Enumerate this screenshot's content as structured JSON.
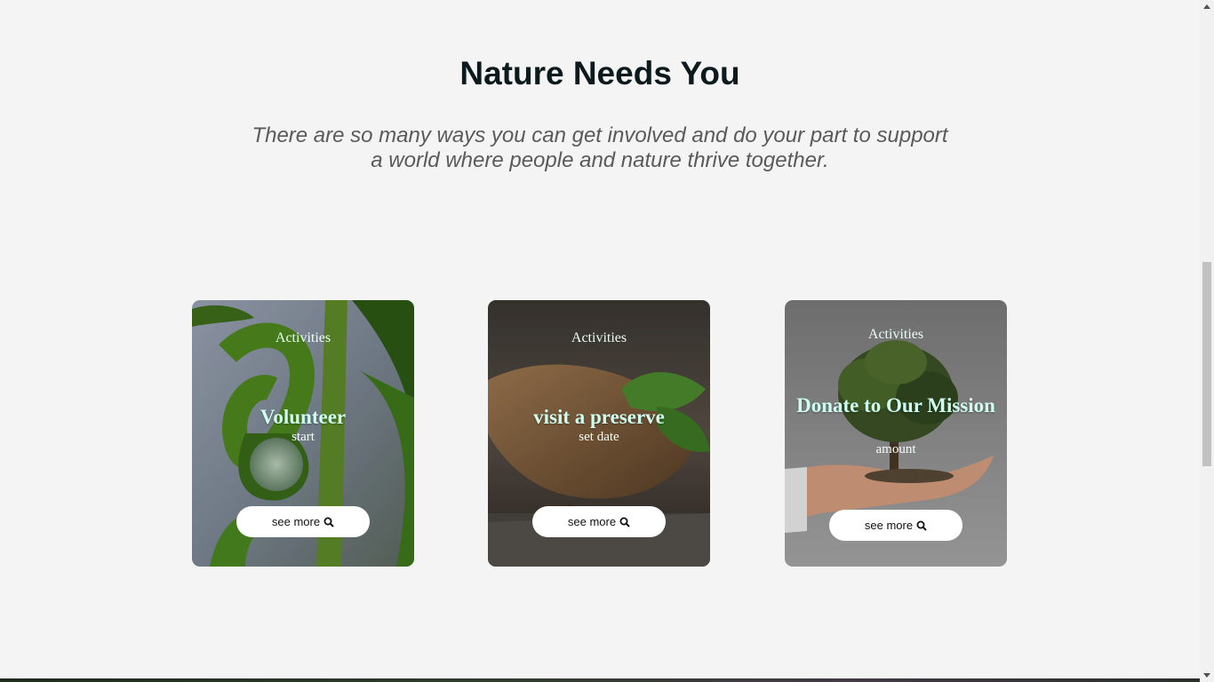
{
  "section": {
    "title": "Nature Needs You",
    "subtitle_line1": "There are so many ways you can get involved and do your part to support",
    "subtitle_line2": "a world where people and nature thrive together."
  },
  "cards": [
    {
      "category": "Activities",
      "name": "Volunteer",
      "sub": "start",
      "button_label": "see more",
      "button_icon": "search-icon"
    },
    {
      "category": "Activities",
      "name": "visit a preserve",
      "sub": "set date",
      "button_label": "see more",
      "button_icon": "search-icon"
    },
    {
      "category": "Activities",
      "name": "Donate to Our Mission",
      "sub": "amount",
      "button_label": "see more",
      "button_icon": "search-icon"
    }
  ],
  "colors": {
    "background": "#f4f4f4",
    "title": "#0c1a1e",
    "subtitle": "#5a5a5a",
    "card_heading": "#cffff0",
    "button_bg": "#ffffff"
  }
}
